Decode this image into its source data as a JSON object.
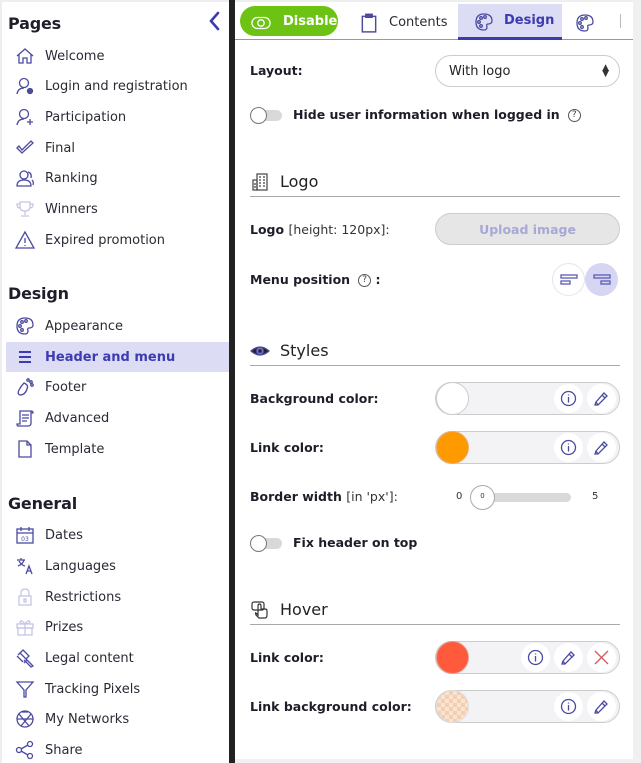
{
  "sidebar": {
    "sections": [
      {
        "title": "Pages",
        "items": [
          {
            "label": "Welcome",
            "icon": "home-icon"
          },
          {
            "label": "Login and registration",
            "icon": "user-login-icon"
          },
          {
            "label": "Participation",
            "icon": "user-add-icon"
          },
          {
            "label": "Final",
            "icon": "checkmark-icon"
          },
          {
            "label": "Ranking",
            "icon": "users-ranking-icon"
          },
          {
            "label": "Winners",
            "icon": "trophy-icon"
          },
          {
            "label": "Expired promotion",
            "icon": "warning-icon"
          }
        ]
      },
      {
        "title": "Design",
        "items": [
          {
            "label": "Appearance",
            "icon": "palette-icon"
          },
          {
            "label": "Header and menu",
            "icon": "menu-icon",
            "active": true
          },
          {
            "label": "Footer",
            "icon": "footprint-icon"
          },
          {
            "label": "Advanced",
            "icon": "scroll-icon"
          },
          {
            "label": "Template",
            "icon": "document-icon"
          }
        ]
      },
      {
        "title": "General",
        "items": [
          {
            "label": "Dates",
            "icon": "calendar-icon",
            "icon_text": "03"
          },
          {
            "label": "Languages",
            "icon": "translate-icon"
          },
          {
            "label": "Restrictions",
            "icon": "lock-icon"
          },
          {
            "label": "Prizes",
            "icon": "gift-icon"
          },
          {
            "label": "Legal content",
            "icon": "gavel-icon"
          },
          {
            "label": "Tracking Pixels",
            "icon": "filter-icon"
          },
          {
            "label": "My Networks",
            "icon": "network-globe-icon"
          },
          {
            "label": "Share",
            "icon": "share-icon"
          }
        ]
      }
    ]
  },
  "toolbar": {
    "disable_label": "Disable",
    "tabs": [
      {
        "label": "Contents",
        "icon": "clipboard-icon"
      },
      {
        "label": "Design",
        "icon": "palette-icon",
        "active": true
      },
      {
        "label": "",
        "icon": "palette-icon"
      }
    ]
  },
  "form": {
    "layout": {
      "label": "Layout:",
      "value": "With logo"
    },
    "hide_user_info": {
      "label": "Hide user information when logged in",
      "checked": false,
      "help": "?"
    },
    "logo_section": {
      "title": "Logo",
      "logo_label": "Logo",
      "logo_hint": "[height: 120px]:",
      "upload_label": "Upload image",
      "menu_position_label": "Menu position",
      "menu_position_colon": ":",
      "menu_position_options": [
        "left",
        "right"
      ],
      "menu_position_selected": "right"
    },
    "styles_section": {
      "title": "Styles",
      "background_color": {
        "label": "Background color:",
        "value": "#ffffff"
      },
      "link_color": {
        "label": "Link color:",
        "value": "#ff9900"
      },
      "border_width": {
        "label": "Border width",
        "hint": "[in 'px']:",
        "min": "0",
        "max": "5",
        "value": "0"
      },
      "fix_header": {
        "label": "Fix header on top",
        "checked": false
      }
    },
    "hover_section": {
      "title": "Hover",
      "link_color": {
        "label": "Link color:",
        "value": "#ff5a3c"
      },
      "link_bg_color": {
        "label": "Link background color:",
        "value": "transparent-peach"
      }
    }
  },
  "colors": {
    "accent": "#3c3cb0",
    "active_bg": "#dcdcf5",
    "disable_button": "#6cc314"
  }
}
